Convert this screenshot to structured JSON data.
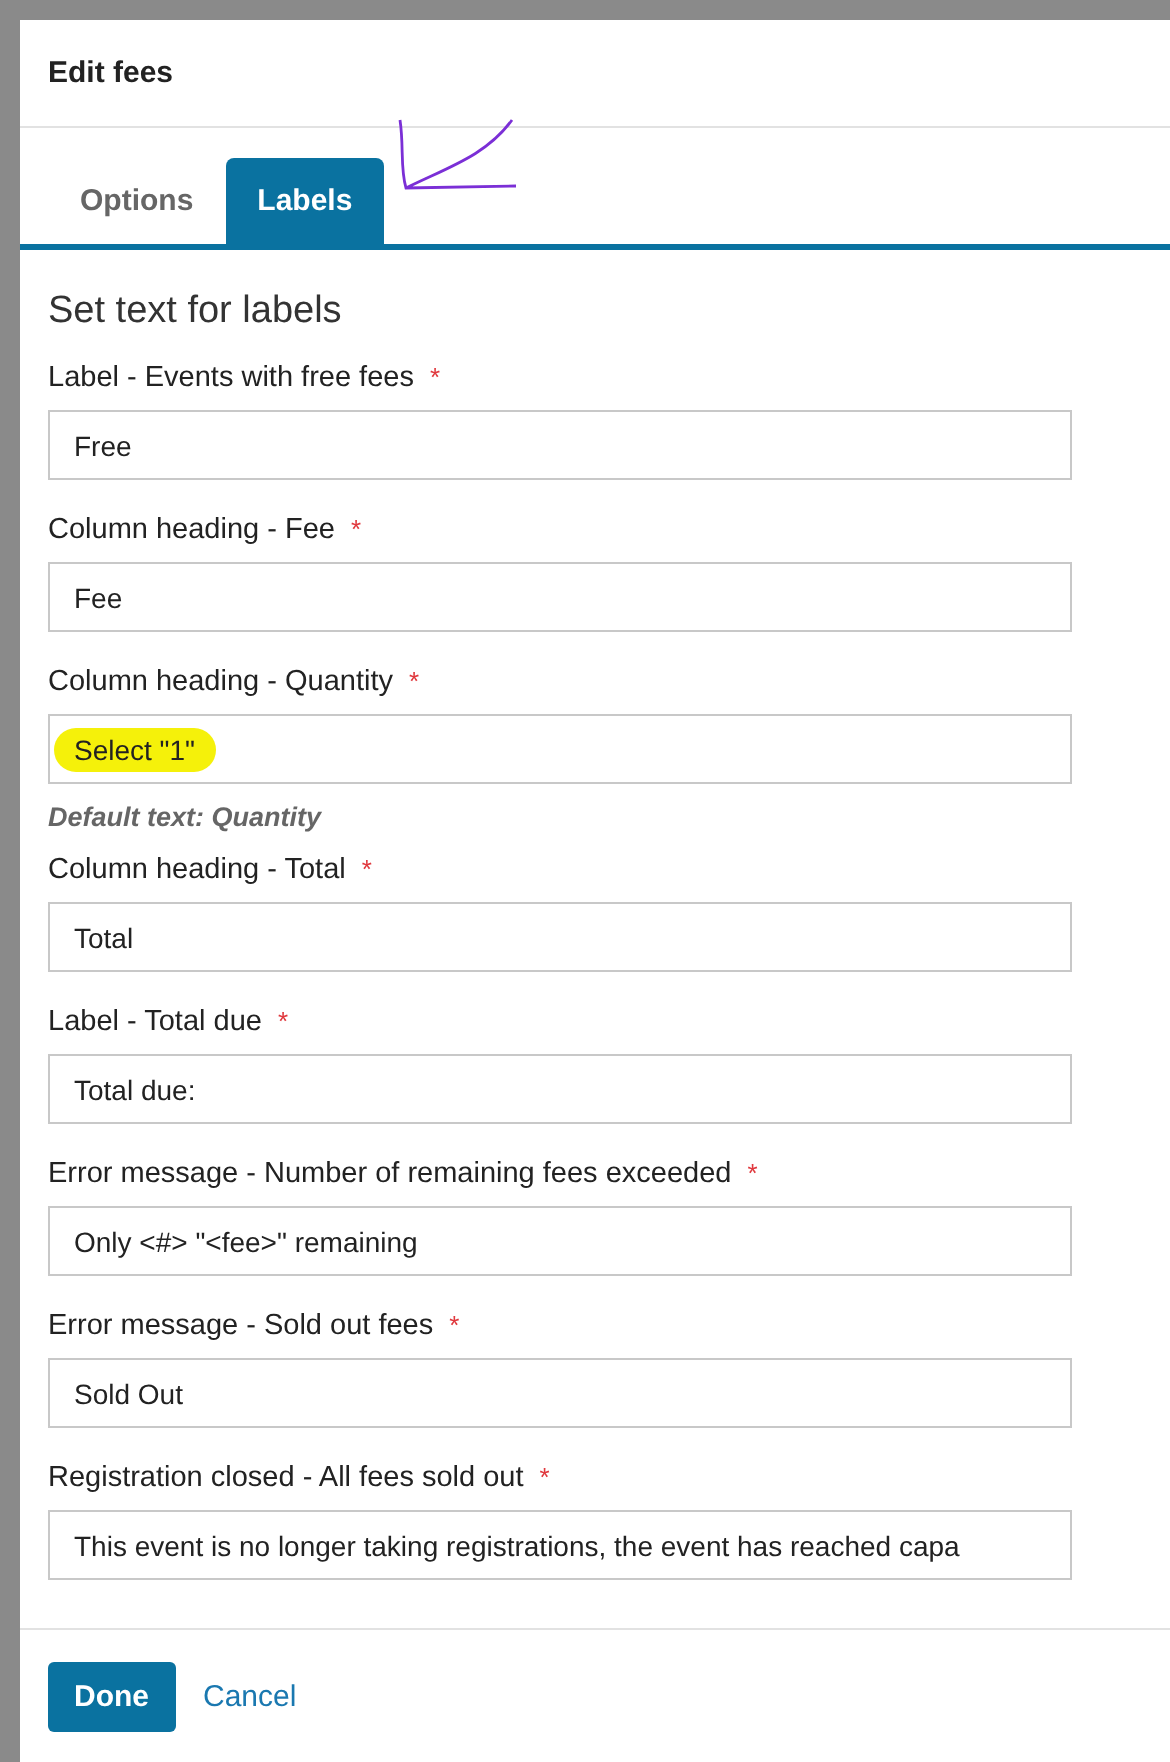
{
  "dialog": {
    "title": "Edit fees"
  },
  "tabs": [
    {
      "label": "Options",
      "selected": false
    },
    {
      "label": "Labels",
      "selected": true
    }
  ],
  "annotation_arrow": true,
  "section_heading": "Set text for labels",
  "fields": [
    {
      "label": "Label - Events with free fees",
      "required": true,
      "value": "Free",
      "highlighted": false
    },
    {
      "label": "Column heading - Fee",
      "required": true,
      "value": "Fee",
      "highlighted": false
    },
    {
      "label": "Column heading - Quantity",
      "required": true,
      "value": "Select \"1\"",
      "highlighted": true,
      "hint": "Default text: Quantity"
    },
    {
      "label": "Column heading - Total",
      "required": true,
      "value": "Total",
      "highlighted": false
    },
    {
      "label": "Label - Total due",
      "required": true,
      "value": "Total due:",
      "highlighted": false
    },
    {
      "label": "Error message - Number of remaining fees exceeded",
      "required": true,
      "value": "Only <#> \"<fee>\" remaining",
      "highlighted": false
    },
    {
      "label": "Error message - Sold out fees",
      "required": true,
      "value": "Sold Out",
      "highlighted": false
    },
    {
      "label": "Registration closed - All fees sold out",
      "required": true,
      "value": "This event is no longer taking registrations, the event has reached capa",
      "highlighted": false
    }
  ],
  "required_mark": "*",
  "buttons": {
    "primary": "Done",
    "secondary": "Cancel"
  }
}
